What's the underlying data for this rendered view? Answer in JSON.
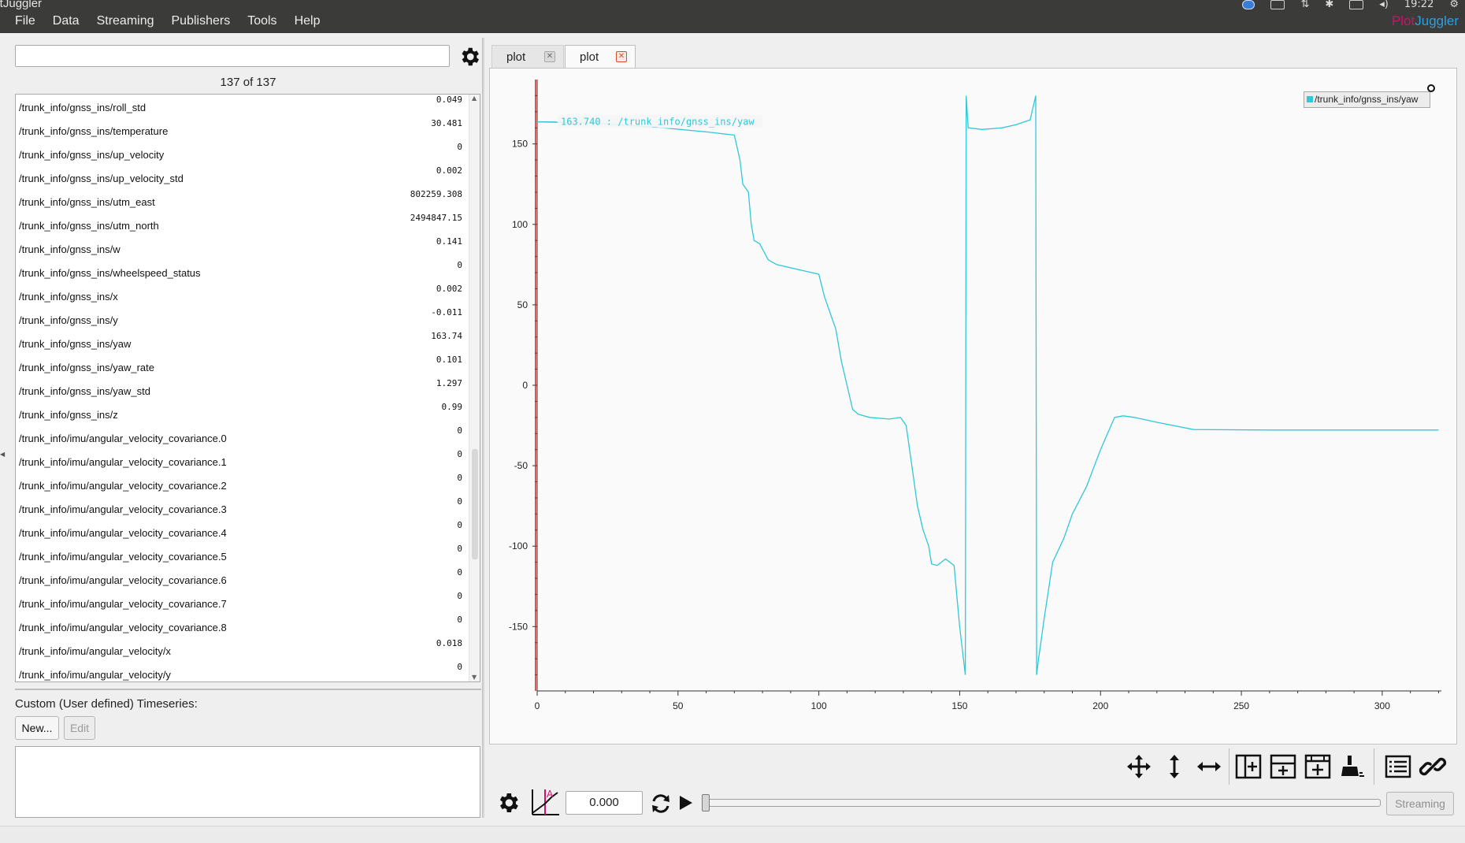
{
  "window": {
    "title": "PlotJuggler"
  },
  "menu": [
    "File",
    "Data",
    "Streaming",
    "Publishers",
    "Tools",
    "Help"
  ],
  "tray": {
    "time": "19:22"
  },
  "brand": {
    "part1": "Plot",
    "part2": "Juggler"
  },
  "left": {
    "filter_value": "",
    "count_label": "137 of 137",
    "items": [
      {
        "name": "/trunk_info/gnss_ins/roll_std",
        "value": "0.049"
      },
      {
        "name": "/trunk_info/gnss_ins/temperature",
        "value": "30.481"
      },
      {
        "name": "/trunk_info/gnss_ins/up_velocity",
        "value": "0"
      },
      {
        "name": "/trunk_info/gnss_ins/up_velocity_std",
        "value": "0.002"
      },
      {
        "name": "/trunk_info/gnss_ins/utm_east",
        "value": "802259.308"
      },
      {
        "name": "/trunk_info/gnss_ins/utm_north",
        "value": "2494847.15"
      },
      {
        "name": "/trunk_info/gnss_ins/w",
        "value": "0.141"
      },
      {
        "name": "/trunk_info/gnss_ins/wheelspeed_status",
        "value": "0"
      },
      {
        "name": "/trunk_info/gnss_ins/x",
        "value": "0.002"
      },
      {
        "name": "/trunk_info/gnss_ins/y",
        "value": "-0.011"
      },
      {
        "name": "/trunk_info/gnss_ins/yaw",
        "value": "163.74"
      },
      {
        "name": "/trunk_info/gnss_ins/yaw_rate",
        "value": "0.101"
      },
      {
        "name": "/trunk_info/gnss_ins/yaw_std",
        "value": "1.297"
      },
      {
        "name": "/trunk_info/gnss_ins/z",
        "value": "0.99"
      },
      {
        "name": "/trunk_info/imu/angular_velocity_covariance.0",
        "value": "0"
      },
      {
        "name": "/trunk_info/imu/angular_velocity_covariance.1",
        "value": "0"
      },
      {
        "name": "/trunk_info/imu/angular_velocity_covariance.2",
        "value": "0"
      },
      {
        "name": "/trunk_info/imu/angular_velocity_covariance.3",
        "value": "0"
      },
      {
        "name": "/trunk_info/imu/angular_velocity_covariance.4",
        "value": "0"
      },
      {
        "name": "/trunk_info/imu/angular_velocity_covariance.5",
        "value": "0"
      },
      {
        "name": "/trunk_info/imu/angular_velocity_covariance.6",
        "value": "0"
      },
      {
        "name": "/trunk_info/imu/angular_velocity_covariance.7",
        "value": "0"
      },
      {
        "name": "/trunk_info/imu/angular_velocity_covariance.8",
        "value": "0"
      },
      {
        "name": "/trunk_info/imu/angular_velocity/x",
        "value": "0.018"
      },
      {
        "name": "/trunk_info/imu/angular_velocity/y",
        "value": "0"
      }
    ],
    "custom_label": "Custom (User defined) Timeseries:",
    "new_label": "New...",
    "edit_label": "Edit"
  },
  "tabs": [
    {
      "label": "plot"
    },
    {
      "label": "plot"
    }
  ],
  "tab_close_glyph": "✕",
  "plot": {
    "tracker_label": "163.740 : /trunk_info/gnss_ins/yaw",
    "legend_label": "/trunk_info/gnss_ins/yaw",
    "line_color": "#30c8d8",
    "tracker_color": "#cc2222"
  },
  "chart_data": {
    "type": "line",
    "title": "",
    "xlabel": "",
    "ylabel": "",
    "xlim": [
      0,
      321
    ],
    "ylim": [
      -190,
      190
    ],
    "xticks": [
      0,
      50,
      100,
      150,
      200,
      250,
      300
    ],
    "yticks": [
      150,
      100,
      50,
      0,
      -50,
      -100,
      -150
    ],
    "grid": false,
    "legend_position": "top-right",
    "series": [
      {
        "name": "/trunk_info/gnss_ins/yaw",
        "points": [
          [
            0,
            163.7
          ],
          [
            20,
            163.0
          ],
          [
            45,
            160.0
          ],
          [
            60,
            157.5
          ],
          [
            70,
            155.5
          ],
          [
            72,
            140
          ],
          [
            73,
            125
          ],
          [
            75,
            120
          ],
          [
            76,
            100
          ],
          [
            77,
            90
          ],
          [
            79,
            88
          ],
          [
            82,
            78
          ],
          [
            85,
            75
          ],
          [
            95,
            71
          ],
          [
            100,
            69
          ],
          [
            102,
            55
          ],
          [
            104,
            45
          ],
          [
            106,
            35
          ],
          [
            108,
            15
          ],
          [
            110,
            0
          ],
          [
            112,
            -15
          ],
          [
            114,
            -18
          ],
          [
            118,
            -20
          ],
          [
            125,
            -21
          ],
          [
            129,
            -20
          ],
          [
            131,
            -25
          ],
          [
            133,
            -50
          ],
          [
            135,
            -75
          ],
          [
            137,
            -90
          ],
          [
            139,
            -100
          ],
          [
            140,
            -111
          ],
          [
            142,
            -112
          ],
          [
            145,
            -108
          ],
          [
            148,
            -112
          ],
          [
            150,
            -150
          ],
          [
            152,
            -180
          ],
          [
            152.3,
            180
          ],
          [
            153,
            160
          ],
          [
            158,
            159
          ],
          [
            165,
            160
          ],
          [
            170,
            162
          ],
          [
            175,
            165
          ],
          [
            177,
            180
          ],
          [
            177.3,
            -180
          ],
          [
            178,
            -170
          ],
          [
            180,
            -145
          ],
          [
            183,
            -110
          ],
          [
            187,
            -95
          ],
          [
            190,
            -80
          ],
          [
            195,
            -63
          ],
          [
            200,
            -40
          ],
          [
            205,
            -20
          ],
          [
            208,
            -19
          ],
          [
            212,
            -20
          ],
          [
            220,
            -23
          ],
          [
            233,
            -27.5
          ],
          [
            260,
            -27.8
          ],
          [
            300,
            -27.8
          ],
          [
            320,
            -27.8
          ]
        ]
      }
    ]
  },
  "bottom": {
    "time_value": "0.000",
    "streaming_label": "Streaming"
  }
}
